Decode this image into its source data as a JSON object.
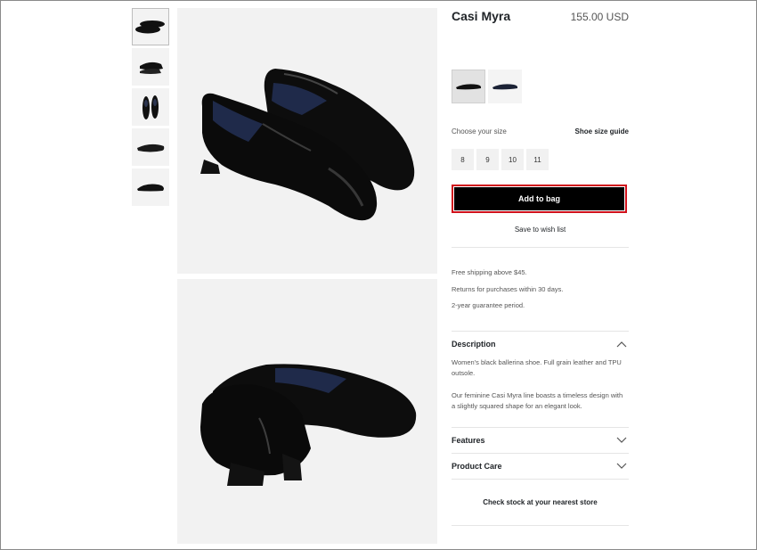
{
  "product": {
    "name": "Casi Myra",
    "price": "155.00 USD"
  },
  "thumbnails": [
    {
      "name": "thumb-view-pair",
      "active": true
    },
    {
      "name": "thumb-view-side"
    },
    {
      "name": "thumb-view-top"
    },
    {
      "name": "thumb-view-sole"
    },
    {
      "name": "thumb-view-profile"
    }
  ],
  "size_selector": {
    "label": "Choose your size",
    "guide_link": "Shoe size guide",
    "sizes": [
      "8",
      "9",
      "10",
      "11"
    ]
  },
  "actions": {
    "add_to_bag": "Add to bag",
    "save_wishlist": "Save to wish list"
  },
  "perks": [
    "Free shipping above $45.",
    "Returns for purchases within 30 days.",
    "2-year guarantee period."
  ],
  "description": {
    "title": "Description",
    "paragraph1": "Women's black ballerina shoe. Full grain leather and TPU outsole.",
    "paragraph2": "Our feminine Casi Myra line boasts a timeless design with a slightly squared shape for an elegant look."
  },
  "features": {
    "title": "Features"
  },
  "product_care": {
    "title": "Product Care"
  },
  "store_check": "Check stock at your nearest store",
  "colors": {
    "button_bg": "#000000",
    "button_outline": "#d0111b",
    "image_bg": "#f2f2f2"
  }
}
